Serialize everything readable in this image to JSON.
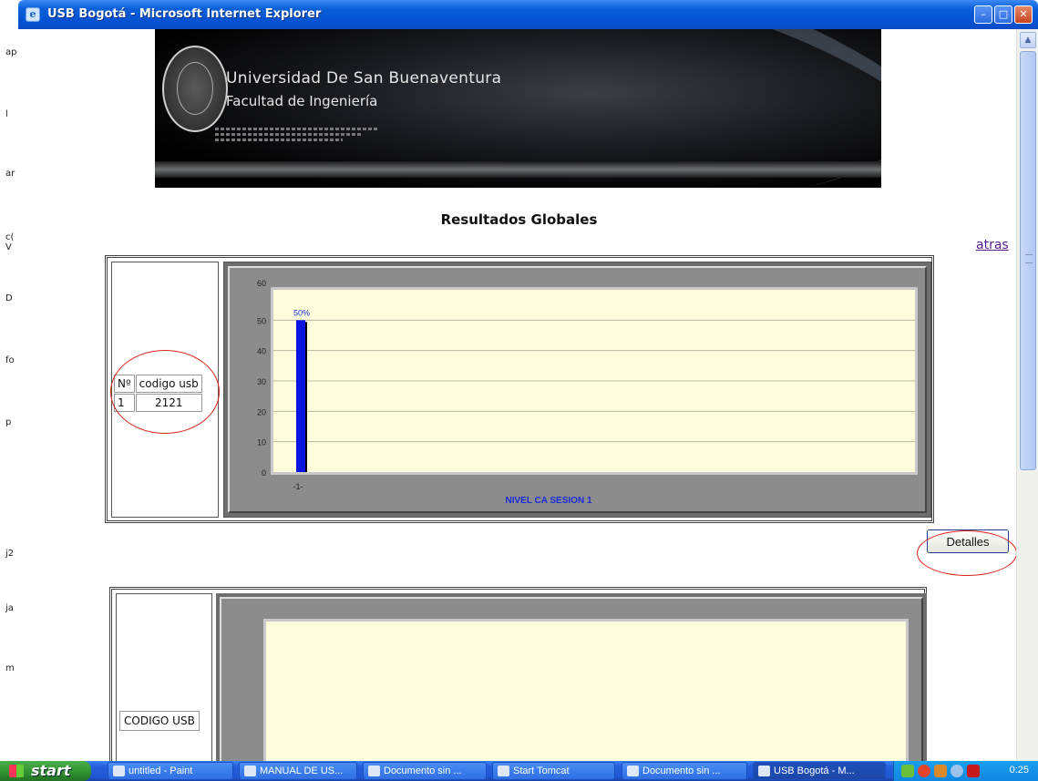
{
  "desktop_strip": [
    "ap",
    "l",
    "ar",
    "c(",
    "V",
    "D",
    "fo",
    "p",
    "j2",
    "ja",
    "m"
  ],
  "window": {
    "title": "USB Bogotá - Microsoft Internet Explorer",
    "buttons": [
      "minimize",
      "maximize",
      "close"
    ]
  },
  "banner": {
    "line1": "Universidad De San Buenaventura",
    "line2": "Facultad de Ingeniería"
  },
  "page": {
    "heading": "Resultados Globales",
    "back_link": "atras",
    "details_button": "Detalles"
  },
  "student_table": {
    "headers": [
      "Nº",
      "codigo usb"
    ],
    "rows": [
      [
        "1",
        "2121"
      ]
    ]
  },
  "chart_data": {
    "type": "bar",
    "categories": [
      "-1-"
    ],
    "values": [
      50
    ],
    "data_labels": [
      "50%"
    ],
    "title": "",
    "xlabel": "NIVEL CA SESION 1",
    "ylabel": "",
    "ylim": [
      0,
      60
    ],
    "yticks": [
      0,
      10,
      20,
      30,
      40,
      50,
      60
    ],
    "grid": true,
    "colors": {
      "bar": "#0a14e0",
      "plot_bg": "#fefedd",
      "xlabel": "#1a2bd8",
      "frame": "#8c8c8c"
    }
  },
  "second_table": {
    "header": "CODIGO USB"
  },
  "taskbar": {
    "start": "start",
    "tasks": [
      "untitled - Paint",
      "MANUAL DE US...",
      "Documento sin ...",
      "Start Tomcat",
      "Documento sin ...",
      "USB Bogotá - M..."
    ],
    "clock": "0:25"
  },
  "annotation_color": "#d9241a"
}
